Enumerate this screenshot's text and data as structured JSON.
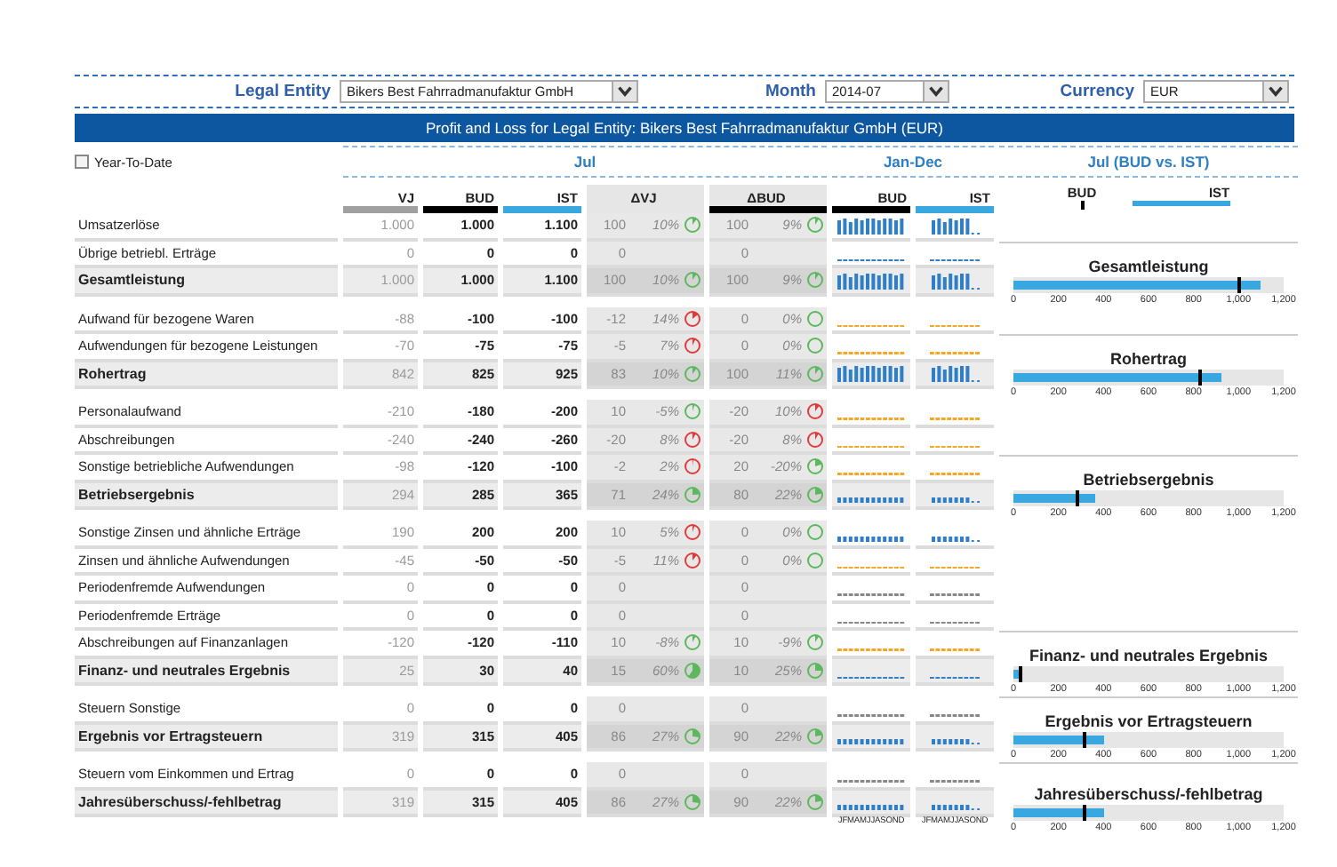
{
  "filters": [
    {
      "label": "Legal Entity",
      "value": "Bikers Best Fahrradmanufaktur GmbH"
    },
    {
      "label": "Month",
      "value": "2014-07"
    },
    {
      "label": "Currency",
      "value": "EUR"
    }
  ],
  "title_bar": "Profit and Loss for Legal Entity: Bikers Best Fahrradmanufaktur GmbH (EUR)",
  "year_to_date": {
    "label": "Year-To-Date",
    "checked": false
  },
  "sections": [
    "Jul",
    "Jan-Dec",
    "Jul (BUD vs. IST)"
  ],
  "columns": [
    {
      "label": "VJ",
      "color": "#a0a0a0"
    },
    {
      "label": "BUD",
      "color": "#000000"
    },
    {
      "label": "IST",
      "color": "#3aa8e0"
    },
    {
      "label": "ΔVJ"
    },
    {
      "label": "ΔBUD",
      "color": "#000000"
    },
    {
      "label": "BUD",
      "color": "#000000"
    },
    {
      "label": "IST",
      "color": "#3aa8e0"
    }
  ],
  "legend": [
    {
      "label": "BUD",
      "kind": "marker",
      "color": "#000000"
    },
    {
      "label": "IST",
      "kind": "bar",
      "color": "#3aa8e0"
    }
  ],
  "table": {
    "groups": [
      {
        "rows": [
          {
            "label": "Umsatzerlöse",
            "kind": "detail",
            "vj": "1.000",
            "bud": "1.000",
            "ist": "1.100",
            "dvj": {
              "value": "100",
              "pct": "10%",
              "color": "#5cb85c"
            },
            "dbud": {
              "value": "100",
              "pct": "9%",
              "color": "#5cb85c"
            },
            "spark": {
              "kind": "bars",
              "color": "#2e7fc8"
            }
          },
          {
            "label": "Übrige betriebl. Erträge",
            "kind": "detail",
            "vj": "0",
            "bud": "0",
            "ist": "0",
            "dvj": {
              "value": "0"
            },
            "dbud": {
              "value": "0"
            },
            "spark": {
              "kind": "dots",
              "color": "#2e7fc8"
            }
          },
          {
            "label": "Gesamtleistung",
            "kind": "total",
            "vj": "1.000",
            "bud": "1.000",
            "ist": "1.100",
            "dvj": {
              "value": "100",
              "pct": "10%",
              "color": "#5cb85c"
            },
            "dbud": {
              "value": "100",
              "pct": "9%",
              "color": "#5cb85c"
            },
            "spark": {
              "kind": "bars",
              "color": "#2e7fc8"
            },
            "bullet": {
              "title": "Gesamtleistung",
              "ist": {
                "level": 0.917
              },
              "bud": {
                "level": 0.833
              },
              "ticks": [
                "0",
                "200",
                "400",
                "600",
                "800",
                "1,000",
                "1,200"
              ]
            }
          }
        ]
      },
      {
        "rows": [
          {
            "label": "Aufwand für bezogene Waren",
            "kind": "detail",
            "vj": "-88",
            "bud": "-100",
            "ist": "-100",
            "dvj": {
              "value": "-12",
              "pct": "14%",
              "color": "#e03a3a"
            },
            "dbud": {
              "value": "0",
              "pct": "0%",
              "color": "#5cb85c"
            },
            "spark": {
              "kind": "dots",
              "color": "#f5a623"
            }
          },
          {
            "label": "Aufwendungen für bezogene Leistungen",
            "kind": "detail",
            "vj": "-70",
            "bud": "-75",
            "ist": "-75",
            "dvj": {
              "value": "-5",
              "pct": "7%",
              "color": "#e03a3a"
            },
            "dbud": {
              "value": "0",
              "pct": "0%",
              "color": "#5cb85c"
            },
            "spark": {
              "kind": "dots",
              "color": "#f5a623"
            }
          },
          {
            "label": "Rohertrag",
            "kind": "total",
            "vj": "842",
            "bud": "825",
            "ist": "925",
            "dvj": {
              "value": "83",
              "pct": "10%",
              "color": "#5cb85c"
            },
            "dbud": {
              "value": "100",
              "pct": "11%",
              "color": "#5cb85c"
            },
            "spark": {
              "kind": "bars",
              "color": "#2e7fc8"
            },
            "bullet": {
              "title": "Rohertrag",
              "ist": {
                "level": 0.771
              },
              "bud": {
                "level": 0.688
              },
              "ticks": [
                "0",
                "200",
                "400",
                "600",
                "800",
                "1,000",
                "1,200"
              ]
            }
          }
        ]
      },
      {
        "rows": [
          {
            "label": "Personalaufwand",
            "kind": "detail",
            "vj": "-210",
            "bud": "-180",
            "ist": "-200",
            "dvj": {
              "value": "10",
              "pct": "-5%",
              "color": "#5cb85c"
            },
            "dbud": {
              "value": "-20",
              "pct": "10%",
              "color": "#e03a3a"
            },
            "spark": {
              "kind": "dots",
              "color": "#f5a623"
            }
          },
          {
            "label": "Abschreibungen",
            "kind": "detail",
            "vj": "-240",
            "bud": "-240",
            "ist": "-260",
            "dvj": {
              "value": "-20",
              "pct": "8%",
              "color": "#e03a3a"
            },
            "dbud": {
              "value": "-20",
              "pct": "8%",
              "color": "#e03a3a"
            },
            "spark": {
              "kind": "dots",
              "color": "#f5a623"
            }
          },
          {
            "label": "Sonstige betriebliche Aufwendungen",
            "kind": "detail",
            "vj": "-98",
            "bud": "-120",
            "ist": "-100",
            "dvj": {
              "value": "-2",
              "pct": "2%",
              "color": "#e03a3a"
            },
            "dbud": {
              "value": "20",
              "pct": "-20%",
              "color": "#5cb85c"
            },
            "spark": {
              "kind": "dots",
              "color": "#f5a623"
            }
          },
          {
            "label": "Betriebsergebnis",
            "kind": "total",
            "vj": "294",
            "bud": "285",
            "ist": "365",
            "dvj": {
              "value": "71",
              "pct": "24%",
              "color": "#5cb85c"
            },
            "dbud": {
              "value": "80",
              "pct": "22%",
              "color": "#5cb85c"
            },
            "spark": {
              "kind": "short-bars",
              "color": "#2e7fc8"
            },
            "bullet": {
              "title": "Betriebsergebnis",
              "ist": {
                "level": 0.304
              },
              "bud": {
                "level": 0.238
              },
              "ticks": [
                "0",
                "200",
                "400",
                "600",
                "800",
                "1,000",
                "1,200"
              ]
            }
          }
        ]
      },
      {
        "rows": [
          {
            "label": "Sonstige Zinsen und ähnliche Erträge",
            "kind": "detail",
            "vj": "190",
            "bud": "200",
            "ist": "200",
            "dvj": {
              "value": "10",
              "pct": "5%",
              "color": "#e03a3a"
            },
            "dbud": {
              "value": "0",
              "pct": "0%",
              "color": "#5cb85c"
            },
            "spark": {
              "kind": "short-bars",
              "color": "#2e7fc8"
            }
          },
          {
            "label": "Zinsen und ähnliche Aufwendungen",
            "kind": "detail",
            "vj": "-45",
            "bud": "-50",
            "ist": "-50",
            "dvj": {
              "value": "-5",
              "pct": "11%",
              "color": "#e03a3a"
            },
            "dbud": {
              "value": "0",
              "pct": "0%",
              "color": "#5cb85c"
            },
            "spark": {
              "kind": "dots",
              "color": "#f5a623"
            }
          },
          {
            "label": "Periodenfremde Aufwendungen",
            "kind": "detail",
            "vj": "0",
            "bud": "0",
            "ist": "0",
            "dvj": {
              "value": "0"
            },
            "dbud": {
              "value": "0"
            },
            "spark": {
              "kind": "dots",
              "color": "#888888"
            }
          },
          {
            "label": "Periodenfremde Erträge",
            "kind": "detail",
            "vj": "0",
            "bud": "0",
            "ist": "0",
            "dvj": {
              "value": "0"
            },
            "dbud": {
              "value": "0"
            },
            "spark": {
              "kind": "dots",
              "color": "#888888"
            }
          },
          {
            "label": "Abschreibungen auf Finanzanlagen",
            "kind": "detail",
            "vj": "-120",
            "bud": "-120",
            "ist": "-110",
            "dvj": {
              "value": "10",
              "pct": "-8%",
              "color": "#5cb85c"
            },
            "dbud": {
              "value": "10",
              "pct": "-9%",
              "color": "#5cb85c"
            },
            "spark": {
              "kind": "dots",
              "color": "#f5a623"
            }
          },
          {
            "label": "Finanz- und neutrales Ergebnis",
            "kind": "total",
            "vj": "25",
            "bud": "30",
            "ist": "40",
            "dvj": {
              "value": "15",
              "pct": "60%",
              "color": "#5cb85c"
            },
            "dbud": {
              "value": "10",
              "pct": "25%",
              "color": "#5cb85c"
            },
            "spark": {
              "kind": "dots",
              "color": "#2e7fc8"
            },
            "bullet": {
              "title": "Finanz- und neutrales Ergebnis",
              "ist": {
                "level": 0.033
              },
              "bud": {
                "level": 0.025
              },
              "ticks": [
                "0",
                "200",
                "400",
                "600",
                "800",
                "1,000",
                "1,200"
              ]
            }
          }
        ]
      },
      {
        "rows": [
          {
            "label": "Steuern Sonstige",
            "kind": "detail",
            "vj": "0",
            "bud": "0",
            "ist": "0",
            "dvj": {
              "value": "0"
            },
            "dbud": {
              "value": "0"
            },
            "spark": {
              "kind": "dots",
              "color": "#888888"
            }
          },
          {
            "label": "Ergebnis vor Ertragsteuern",
            "kind": "total",
            "vj": "319",
            "bud": "315",
            "ist": "405",
            "dvj": {
              "value": "86",
              "pct": "27%",
              "color": "#5cb85c"
            },
            "dbud": {
              "value": "90",
              "pct": "22%",
              "color": "#5cb85c"
            },
            "spark": {
              "kind": "short-bars",
              "color": "#2e7fc8"
            },
            "bullet": {
              "title": "Ergebnis vor Ertragsteuern",
              "ist": {
                "level": 0.338
              },
              "bud": {
                "level": 0.263
              },
              "ticks": [
                "0",
                "200",
                "400",
                "600",
                "800",
                "1,000",
                "1,200"
              ]
            }
          }
        ]
      },
      {
        "rows": [
          {
            "label": "Steuern vom Einkommen und Ertrag",
            "kind": "detail",
            "vj": "0",
            "bud": "0",
            "ist": "0",
            "dvj": {
              "value": "0"
            },
            "dbud": {
              "value": "0"
            },
            "spark": {
              "kind": "dots",
              "color": "#888888"
            }
          },
          {
            "label": "Jahresüberschuss/-fehlbetrag",
            "kind": "total",
            "vj": "319",
            "bud": "315",
            "ist": "405",
            "dvj": {
              "value": "86",
              "pct": "27%",
              "color": "#5cb85c"
            },
            "dbud": {
              "value": "90",
              "pct": "22%",
              "color": "#5cb85c"
            },
            "spark": {
              "kind": "short-bars",
              "color": "#2e7fc8"
            },
            "bullet": {
              "title": "Jahresüberschuss/-fehlbetrag",
              "ist": {
                "level": 0.338
              },
              "bud": {
                "level": 0.263
              },
              "ticks": [
                "0",
                "200",
                "400",
                "600",
                "800",
                "1,000",
                "1,200"
              ]
            }
          }
        ]
      }
    ]
  },
  "month_axis": [
    "JFMAMJJASOND",
    "JFMAMJJASOND"
  ]
}
